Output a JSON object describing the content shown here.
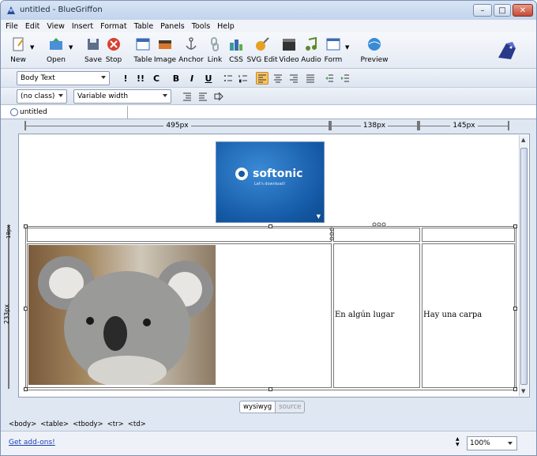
{
  "window": {
    "title": "untitled - BlueGriffon"
  },
  "titlebar": {
    "min_glyph": "–",
    "max_glyph": "□",
    "close_glyph": "✕"
  },
  "menu": [
    "File",
    "Edit",
    "View",
    "Insert",
    "Format",
    "Table",
    "Panels",
    "Tools",
    "Help"
  ],
  "toolbar": {
    "new": "New",
    "open": "Open",
    "save": "Save",
    "stop": "Stop",
    "table": "Table",
    "image": "Image",
    "anchor": "Anchor",
    "link": "Link",
    "css": "CSS",
    "svg_edit": "SVG Edit",
    "video": "Video",
    "audio": "Audio",
    "form": "Form",
    "preview": "Preview"
  },
  "format1": {
    "paragraph_style": "Body Text",
    "btn_important": "!",
    "btn_strong": "!!",
    "btn_clear": "C",
    "btn_bold": "B",
    "btn_italic": "I",
    "btn_underline": "U"
  },
  "format2": {
    "class_select": "(no class)",
    "width_select": "Variable width"
  },
  "tabs": [
    {
      "label": "untitled"
    }
  ],
  "ruler": [
    {
      "label": "495px"
    },
    {
      "label": "138px"
    },
    {
      "label": "145px"
    }
  ],
  "editor": {
    "banner_logo": "softonic",
    "banner_tagline": "Let's download!",
    "row1_height_label": "18px",
    "row2_height_label": "233px",
    "cell2_text": "En algún lugar",
    "cell3_text": "Hay una carpa"
  },
  "mode_tabs": {
    "wysiwyg": "wysiwyg",
    "source": "source"
  },
  "element_path": [
    "<body>",
    "<table>",
    "<tbody>",
    "<tr>",
    "<td>"
  ],
  "status": {
    "addons_link": "Get add-ons!",
    "zoom": "100%"
  }
}
